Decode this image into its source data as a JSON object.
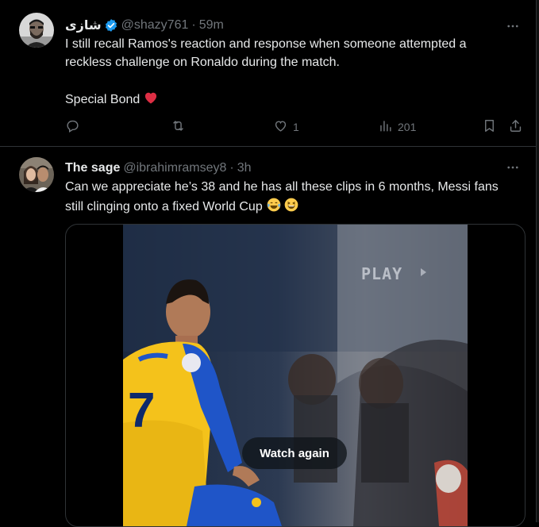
{
  "tweets": [
    {
      "display_name": "شازی",
      "verified": true,
      "handle": "@shazy761",
      "time": "59m",
      "text_lines": [
        "I still recall Ramos's reaction and response when someone attempted a",
        "reckless challenge on Ronaldo during the match.",
        "Special Bond"
      ],
      "emoji": "red-heart",
      "actions": {
        "reply_count": "",
        "retweet_count": "",
        "like_count": "1",
        "views_count": "201"
      }
    },
    {
      "display_name": "The sage",
      "handle": "@ibrahimramsey8",
      "time": "3h",
      "text_lines": [
        "Can we appreciate he’s 38 and he has all these clips in 6 months, Messi fans",
        "still clinging onto a fixed World Cup"
      ],
      "emojis": [
        "face-with-tears-of-joy",
        "grinning-squinting-face"
      ],
      "media": {
        "overlay_text": "PLAY",
        "watch_again_label": "Watch again"
      }
    }
  ],
  "separator": "·",
  "colors": {
    "background": "#000000",
    "text": "#e7e9ea",
    "muted": "#71767b",
    "border": "#2f3336",
    "verified": "#1d9bf0",
    "heart": "#f91880",
    "jersey_yellow": "#f4c21b",
    "jersey_blue": "#1f55c8"
  }
}
